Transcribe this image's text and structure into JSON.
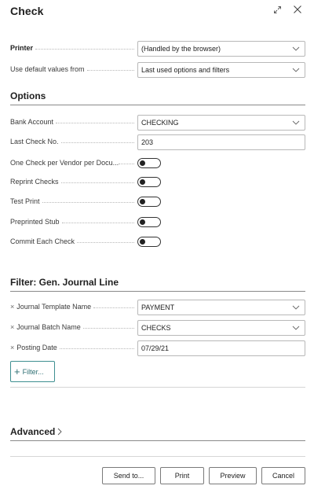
{
  "dialog": {
    "title": "Check"
  },
  "printer": {
    "label": "Printer",
    "value": "(Handled by the browser)"
  },
  "default_values": {
    "label": "Use default values from",
    "value": "Last used options and filters"
  },
  "options": {
    "heading": "Options",
    "bank_account": {
      "label": "Bank Account",
      "value": "CHECKING"
    },
    "last_check_no": {
      "label": "Last Check No.",
      "value": "203"
    },
    "toggles": [
      {
        "label": "One Check per Vendor per Docu...",
        "on": false
      },
      {
        "label": "Reprint Checks",
        "on": false
      },
      {
        "label": "Test Print",
        "on": false
      },
      {
        "label": "Preprinted Stub",
        "on": false
      },
      {
        "label": "Commit Each Check",
        "on": false
      }
    ]
  },
  "filter": {
    "heading": "Filter: Gen. Journal Line",
    "remove_mark": "×",
    "rows": [
      {
        "label": "Journal Template Name",
        "value": "PAYMENT"
      },
      {
        "label": "Journal Batch Name",
        "value": "CHECKS"
      },
      {
        "label": "Posting Date",
        "value": "07/29/21"
      }
    ],
    "add_label": "Filter..."
  },
  "advanced": {
    "label": "Advanced"
  },
  "footer": {
    "send_to": "Send to...",
    "print": "Print",
    "preview": "Preview",
    "cancel": "Cancel"
  }
}
